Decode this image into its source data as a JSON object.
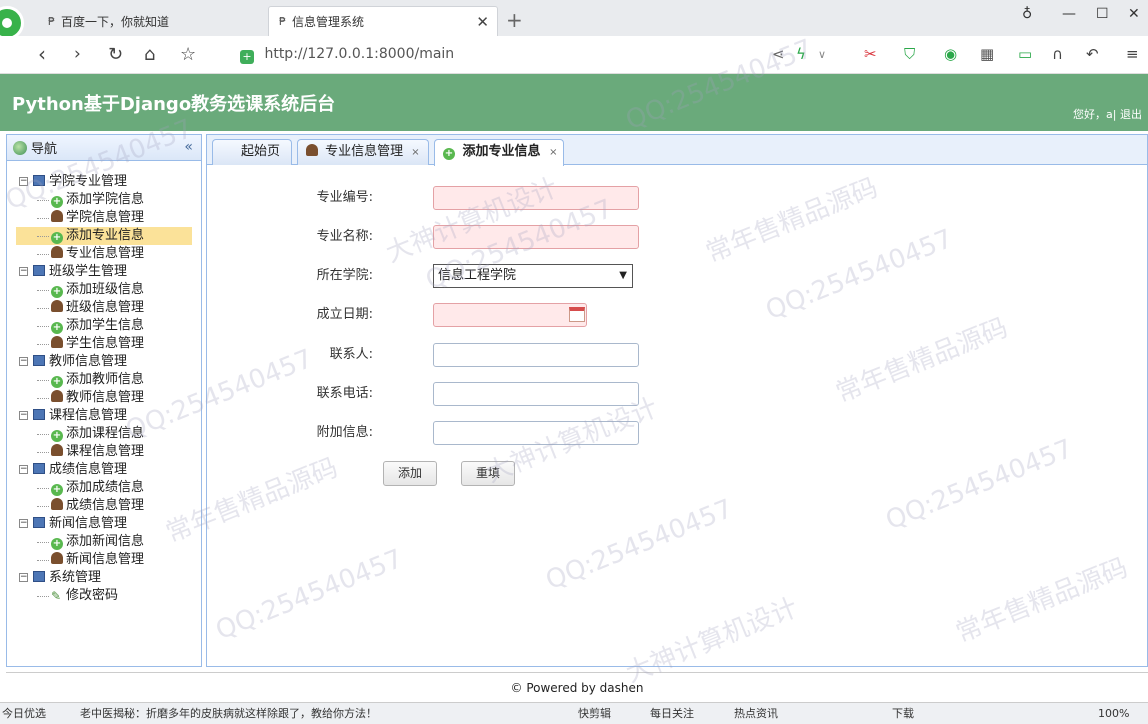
{
  "browser": {
    "tabs": [
      {
        "label": "百度一下，你就知道"
      },
      {
        "label": "信息管理系统"
      }
    ],
    "url": "http://127.0.0.1:8000/main"
  },
  "header": {
    "title": "Python基于Django教务选课系统后台",
    "welcome": "您好，a| 退出"
  },
  "nav": {
    "title": "导航",
    "groups": [
      {
        "label": "学院专业管理",
        "items": [
          "添加学院信息",
          "学院信息管理",
          "添加专业信息",
          "专业信息管理"
        ]
      },
      {
        "label": "班级学生管理",
        "items": [
          "添加班级信息",
          "班级信息管理",
          "添加学生信息",
          "学生信息管理"
        ]
      },
      {
        "label": "教师信息管理",
        "items": [
          "添加教师信息",
          "教师信息管理"
        ]
      },
      {
        "label": "课程信息管理",
        "items": [
          "添加课程信息",
          "课程信息管理"
        ]
      },
      {
        "label": "成绩信息管理",
        "items": [
          "添加成绩信息",
          "成绩信息管理"
        ]
      },
      {
        "label": "新闻信息管理",
        "items": [
          "添加新闻信息",
          "新闻信息管理"
        ]
      },
      {
        "label": "系统管理",
        "items": [
          "修改密码"
        ]
      }
    ]
  },
  "content_tabs": [
    "起始页",
    "专业信息管理",
    "添加专业信息"
  ],
  "form": {
    "specialty_no_label": "专业编号:",
    "specialty_name_label": "专业名称:",
    "college_label": "所在学院:",
    "college_value": "信息工程学院",
    "date_label": "成立日期:",
    "contact_label": "联系人:",
    "phone_label": "联系电话:",
    "extra_label": "附加信息:",
    "add_button": "添加",
    "reset_button": "重填"
  },
  "footer": "© Powered by dashen",
  "statusbar": {
    "left": "今日优选",
    "news": "老中医揭秘：折磨多年的皮肤病就这样除跟了，教给你方法！",
    "items": [
      "快剪辑",
      "每日关注",
      "热点资讯",
      "下载",
      "100%"
    ]
  },
  "watermarks": [
    "QQ:254540457",
    "常年售精品源码",
    "大神计算机设计"
  ]
}
